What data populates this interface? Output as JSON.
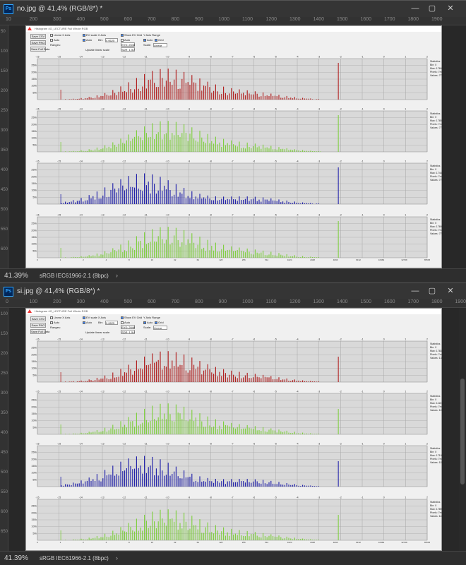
{
  "windows": [
    {
      "title": "no.jpg @ 41,4% (RGB/8*) *",
      "ps": "Ps",
      "zoom": "41.39%",
      "profile": "sRGB IEC61966-2.1 (8bpc)",
      "ruler": [
        "10",
        "200",
        "300",
        "400",
        "500",
        "600",
        "700",
        "800",
        "900",
        "1000",
        "1100",
        "1200",
        "1300",
        "1400",
        "1500",
        "1600",
        "1700",
        "1800",
        "1900"
      ],
      "ruler_left": [
        "50",
        "100",
        "150",
        "200",
        "250",
        "300",
        "350",
        "400",
        "450",
        "500",
        "550",
        "600"
      ],
      "scrollbar": false,
      "app": {
        "title": "Histogram 4G_LECTURE Full Whole RGB",
        "save_csv": "Save CSV",
        "save_png": "Save PNG",
        "save_full": "Save Full Data",
        "linear_x": "Linear X Axis",
        "ev_scale": "EV scale X Axis",
        "show_ev": "Show EV Grid",
        "y_axis_range": "Y Axis Range",
        "auto": "Auto",
        "grid": "Grid",
        "range": "Ranges:",
        "bin": "Bin:",
        "scale": "Scale:",
        "update": "Update linear scale",
        "bin_val": "0.0625",
        "scale_val": "Linear",
        "evs": "EVS: 2048",
        "evs2": "SDR: 1.5V"
      },
      "stats": [
        {
          "t": "Statistics",
          "a": "Bin: 0",
          "b": "Max: 178437",
          "c": "Pixels: 7m",
          "d": "Values: 77777"
        },
        {
          "t": "Statistics",
          "a": "Bin: 0",
          "b": "Max: 178590",
          "c": "Pixels: 7m",
          "d": "Values: 77777"
        },
        {
          "t": "Statistics",
          "a": "Bin: 0",
          "b": "Max: 174437",
          "c": "Pixels: 7m",
          "d": "Values: 77350"
        },
        {
          "t": "Statistics",
          "a": "Bin: 0",
          "b": "Max: 176980",
          "c": "Pixels: 7m",
          "d": "Values: 77690"
        }
      ]
    },
    {
      "title": "si.jpg @ 41,4% (RGB/8*) *",
      "ps": "Ps",
      "zoom": "41.39%",
      "profile": "sRGB IEC61966-2.1 (8bpc)",
      "ruler": [
        "0",
        "100",
        "200",
        "300",
        "400",
        "500",
        "600",
        "700",
        "800",
        "900",
        "1000",
        "1100",
        "1200",
        "1300",
        "1400",
        "1500",
        "1600",
        "1700",
        "1800",
        "1900"
      ],
      "ruler_left": [
        "100",
        "150",
        "200",
        "250",
        "300",
        "350",
        "400",
        "450",
        "500",
        "550",
        "600",
        "650"
      ],
      "scrollbar": true,
      "app": {
        "title": "Histogram 4G_LECTURE Full Whole RGB",
        "save_csv": "Save CSV",
        "save_png": "Save PNG",
        "save_full": "Save Full Data",
        "linear_x": "Linear X Axis",
        "ev_scale": "EV scale X Axis",
        "show_ev": "Show EV Grid",
        "y_axis_range": "Y Axis Range",
        "auto": "Auto",
        "grid": "Grid",
        "range": "Ranges:",
        "bin": "Bin:",
        "scale": "Scale:",
        "update": "Update linear scale",
        "bin_val": "0.0625",
        "scale_val": "Linear",
        "evs": "EVS: 2048",
        "evs2": "SDR: 1.5V"
      },
      "stats": [
        {
          "t": "Statistics",
          "a": "Bin: 0",
          "b": "Max: 178390",
          "c": "Pixels: 7m",
          "d": "Values: 134813"
        },
        {
          "t": "Statistics",
          "a": "Bin: 0",
          "b": "Max: 111019",
          "c": "Pixels: 7m",
          "d": "Values: 111011"
        },
        {
          "t": "Statistics",
          "a": "Bin: 0",
          "b": "Max: 171998",
          "c": "Pixels: 7m",
          "d": "Values: 115348"
        },
        {
          "t": "Statistics",
          "a": "Bin: 0",
          "b": "Max: 178998",
          "c": "Pixels: 7m",
          "d": "Values: 111209"
        }
      ]
    }
  ],
  "panel_colors": [
    "#b01818",
    "#7ccf3a",
    "#1a1aa8",
    "#7ccf3a"
  ],
  "xticks": [
    "-16",
    "-15",
    "-14",
    "-13",
    "-12",
    "-11",
    "-10",
    "-9",
    "-8",
    "-7",
    "-6",
    "-5",
    "-4",
    "-3",
    "-2",
    "-1",
    "0",
    "1",
    "2"
  ],
  "yticks": [
    "250k",
    "200k",
    "150k",
    "100k",
    "50k"
  ],
  "bottom_ticks": [
    "0",
    "1",
    "2",
    "4",
    "8",
    "16",
    "32",
    "64",
    "128",
    "256",
    "512",
    "1024",
    "2048",
    "4096",
    "8192",
    "16384",
    "32768",
    "65535"
  ],
  "window_controls": {
    "min": "—",
    "max": "▢",
    "close": "✕"
  }
}
